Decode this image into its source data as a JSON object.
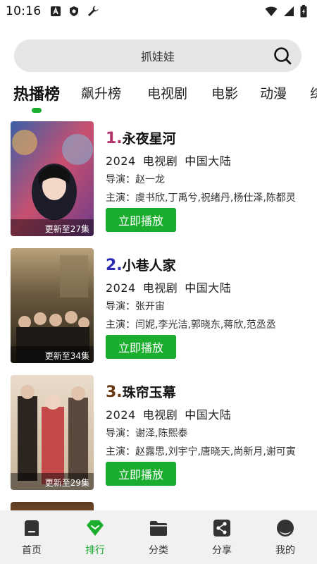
{
  "status_bar": {
    "time": "10:16",
    "icons_left": [
      "text-a-icon",
      "shield-icon",
      "wrench-icon"
    ],
    "icons_right": [
      "wifi-icon",
      "signal-icon",
      "battery-icon"
    ]
  },
  "search": {
    "text": "抓娃娃",
    "icon": "search-icon"
  },
  "tabs": [
    {
      "label": "热播榜",
      "active": true
    },
    {
      "label": "飙升榜",
      "active": false
    },
    {
      "label": "电视剧",
      "active": false
    },
    {
      "label": "电影",
      "active": false
    },
    {
      "label": "动漫",
      "active": false
    },
    {
      "label": "综",
      "active": false
    }
  ],
  "colors": {
    "accent": "#1aad2e",
    "rank1": "#b0336a",
    "rank2": "#2a2ab5",
    "rank3": "#6b3a12"
  },
  "items": [
    {
      "rank": "1.",
      "title": "永夜星河",
      "year": "2024",
      "type": "电视剧",
      "region": "中国大陆",
      "director": "导演：赵一龙",
      "cast": "主演：虞书欣,丁禹兮,祝绪丹,杨仕泽,陈都灵",
      "badge": "更新至27集",
      "button": "立即播放"
    },
    {
      "rank": "2.",
      "title": "小巷人家",
      "year": "2024",
      "type": "电视剧",
      "region": "中国大陆",
      "director": "导演：张开宙",
      "cast": "主演：闫妮,李光洁,郭晓东,蒋欣,范丞丞",
      "badge": "更新至34集",
      "button": "立即播放"
    },
    {
      "rank": "3.",
      "title": "珠帘玉幕",
      "year": "2024",
      "type": "电视剧",
      "region": "中国大陆",
      "director": "导演：谢泽,陈熙泰",
      "cast": "主演：赵露思,刘宇宁,唐晓天,尚新月,谢可寅",
      "badge": "更新至29集",
      "button": "立即播放"
    }
  ],
  "bottom_nav": [
    {
      "label": "首页",
      "icon": "home-icon",
      "active": false
    },
    {
      "label": "排行",
      "icon": "ranking-diamond-icon",
      "active": true
    },
    {
      "label": "分类",
      "icon": "folder-icon",
      "active": false
    },
    {
      "label": "分享",
      "icon": "share-icon",
      "active": false
    },
    {
      "label": "我的",
      "icon": "profile-icon",
      "active": false
    }
  ]
}
